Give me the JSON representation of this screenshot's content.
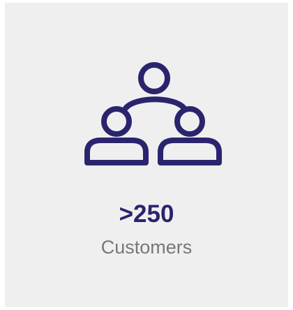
{
  "stat": {
    "value": ">250",
    "label": "Customers",
    "icon": "customers-group-icon"
  },
  "colors": {
    "accent": "#2a246e",
    "label": "#777777",
    "card_background": "#efefef"
  }
}
